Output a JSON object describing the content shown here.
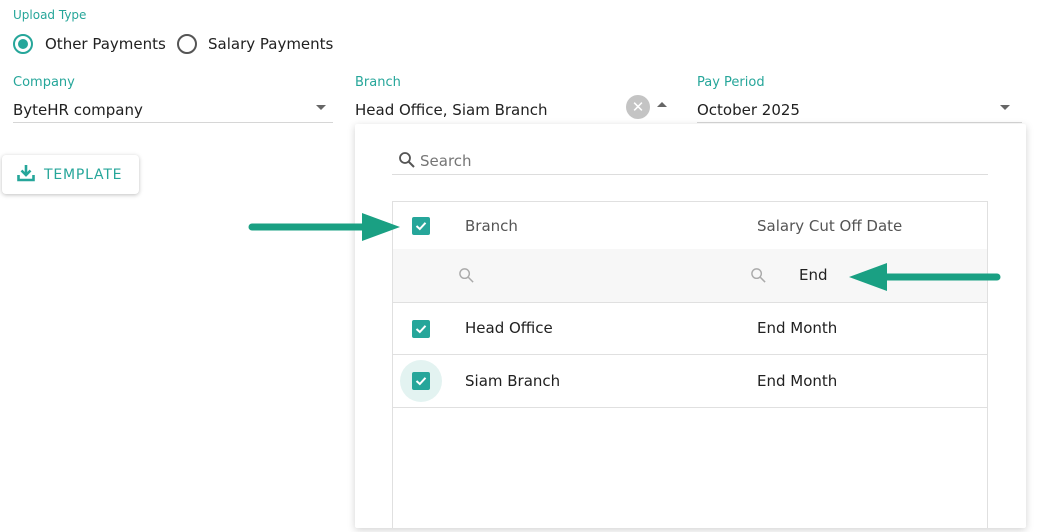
{
  "upload_type": {
    "label": "Upload Type",
    "options": [
      {
        "label": "Other Payments",
        "checked": true
      },
      {
        "label": "Salary Payments",
        "checked": false
      }
    ]
  },
  "company": {
    "label": "Company",
    "value": "ByteHR company"
  },
  "branch": {
    "label": "Branch",
    "value": "Head Office, Siam Branch"
  },
  "pay_period": {
    "label": "Pay Period",
    "value": "October 2025"
  },
  "template_button": {
    "label": "TEMPLATE",
    "icon": "download-icon"
  },
  "dropdown": {
    "search_placeholder": "Search",
    "columns": [
      "Branch",
      "Salary Cut Off Date"
    ],
    "filters": {
      "branch": "",
      "salary_cut_off_date": "End"
    },
    "rows": [
      {
        "branch": "Head Office",
        "salary_cut_off_date": "End Month",
        "checked": true
      },
      {
        "branch": "Siam Branch",
        "salary_cut_off_date": "End Month",
        "checked": true
      }
    ],
    "select_all_checked": true
  },
  "colors": {
    "accent": "#26a69a",
    "arrow": "#1aa083"
  }
}
